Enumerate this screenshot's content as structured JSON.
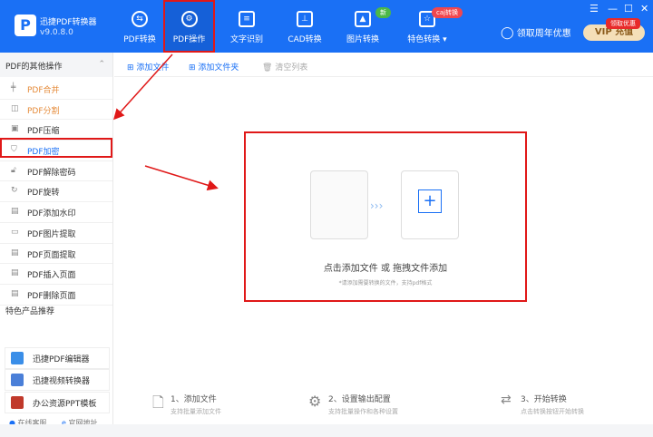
{
  "app": {
    "name": "迅捷PDF转换器",
    "version": "v9.0.8.0",
    "logo": "P"
  },
  "tabs": [
    {
      "label": "PDF转换",
      "icon": "convert-icon"
    },
    {
      "label": "PDF操作",
      "icon": "gear-icon"
    },
    {
      "label": "文字识别",
      "icon": "ocr-icon"
    },
    {
      "label": "CAD转换",
      "icon": "cad-icon"
    },
    {
      "label": "图片转换",
      "icon": "image-icon",
      "badge": "新"
    },
    {
      "label": "特色转换",
      "icon": "star-icon",
      "badge": "caj转换"
    }
  ],
  "header": {
    "user": "领取周年优惠",
    "vip": "VIP 充值",
    "vip_badge": "领取优惠"
  },
  "sidebar": {
    "title": "PDF的其他操作",
    "items": [
      {
        "label": "PDF合并",
        "icon": "merge-icon"
      },
      {
        "label": "PDF分割",
        "icon": "split-icon"
      },
      {
        "label": "PDF压缩",
        "icon": "compress-icon"
      },
      {
        "label": "PDF加密",
        "icon": "shield-icon"
      },
      {
        "label": "PDF解除密码",
        "icon": "lock-icon"
      },
      {
        "label": "PDF旋转",
        "icon": "rotate-icon"
      },
      {
        "label": "PDF添加水印",
        "icon": "watermark-icon"
      },
      {
        "label": "PDF图片提取",
        "icon": "image-icon"
      },
      {
        "label": "PDF页面提取",
        "icon": "page-icon"
      },
      {
        "label": "PDF插入页面",
        "icon": "insert-icon"
      },
      {
        "label": "PDF删除页面",
        "icon": "delete-icon"
      }
    ],
    "rec_title": "特色产品推荐",
    "recs": [
      "迅捷PDF编辑器",
      "迅捷视频转换器",
      "办公资源PPT模板"
    ],
    "service": "在线客服",
    "website": "官网地址"
  },
  "toolbar": {
    "add_file": "添加文件",
    "add_folder": "添加文件夹",
    "clear": "清空列表"
  },
  "drop": {
    "title": "点击添加文件 或 拖拽文件添加",
    "hint": "*请添加需要转换的文件，支持pdf格式"
  },
  "steps": [
    {
      "title": "1、添加文件",
      "sub": "支持批量添加文件"
    },
    {
      "title": "2、设置输出配置",
      "sub": "支持批量操作和各种设置"
    },
    {
      "title": "3、开始转换",
      "sub": "点击转换按钮开始转换"
    }
  ]
}
